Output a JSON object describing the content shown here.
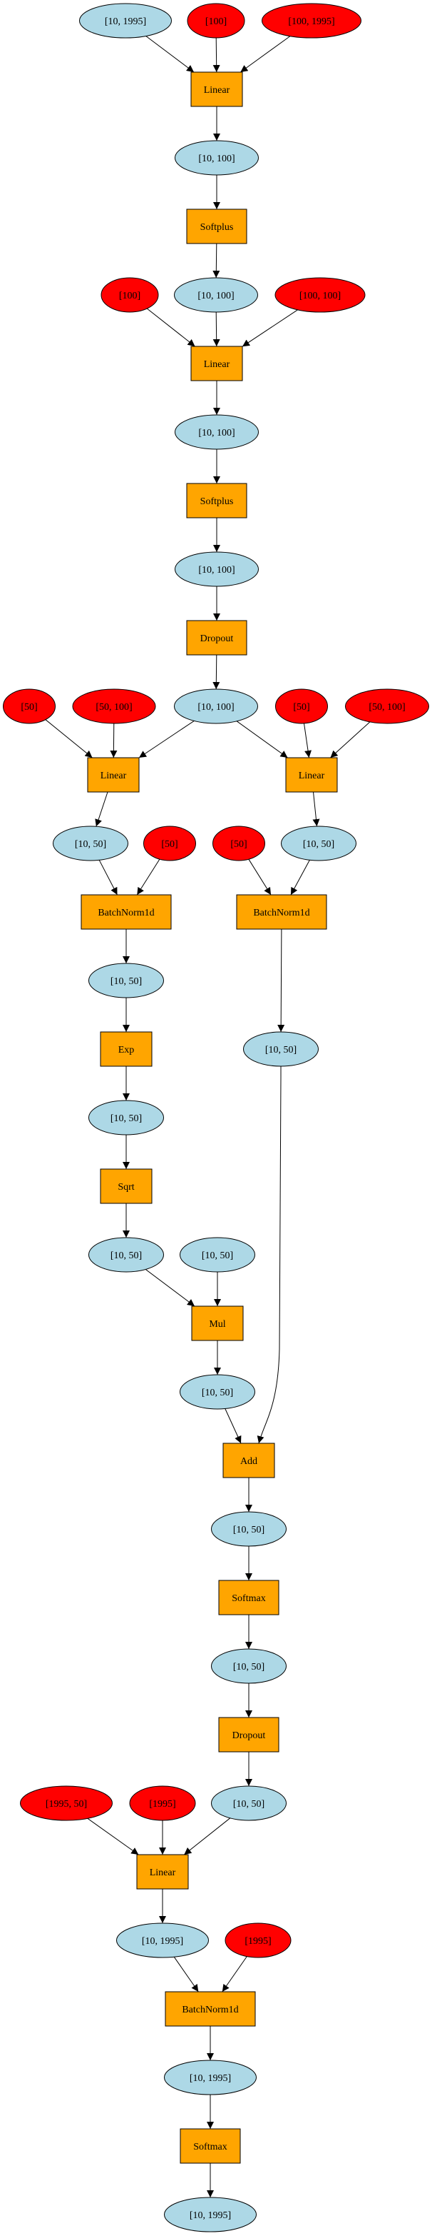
{
  "colors": {
    "tensor": "#add8e6",
    "parameter": "#ff0000",
    "operation": "#ffa500"
  },
  "nodes": [
    {
      "id": "n1",
      "kind": "tensor",
      "label": "[10, 1995]"
    },
    {
      "id": "n2",
      "kind": "parameter",
      "label": "[100]"
    },
    {
      "id": "n3",
      "kind": "parameter",
      "label": "[100, 1995]"
    },
    {
      "id": "op1",
      "kind": "operation",
      "label": "Linear"
    },
    {
      "id": "n4",
      "kind": "tensor",
      "label": "[10, 100]"
    },
    {
      "id": "op2",
      "kind": "operation",
      "label": "Softplus"
    },
    {
      "id": "n5",
      "kind": "parameter",
      "label": "[100]"
    },
    {
      "id": "n6",
      "kind": "tensor",
      "label": "[10, 100]"
    },
    {
      "id": "n7",
      "kind": "parameter",
      "label": "[100, 100]"
    },
    {
      "id": "op3",
      "kind": "operation",
      "label": "Linear"
    },
    {
      "id": "n8",
      "kind": "tensor",
      "label": "[10, 100]"
    },
    {
      "id": "op4",
      "kind": "operation",
      "label": "Softplus"
    },
    {
      "id": "n9",
      "kind": "tensor",
      "label": "[10, 100]"
    },
    {
      "id": "op5",
      "kind": "operation",
      "label": "Dropout"
    },
    {
      "id": "n10",
      "kind": "parameter",
      "label": "[50]"
    },
    {
      "id": "n11",
      "kind": "parameter",
      "label": "[50, 100]"
    },
    {
      "id": "n12",
      "kind": "tensor",
      "label": "[10, 100]"
    },
    {
      "id": "n13",
      "kind": "parameter",
      "label": "[50]"
    },
    {
      "id": "n14",
      "kind": "parameter",
      "label": "[50, 100]"
    },
    {
      "id": "op6",
      "kind": "operation",
      "label": "Linear"
    },
    {
      "id": "op7",
      "kind": "operation",
      "label": "Linear"
    },
    {
      "id": "n15",
      "kind": "tensor",
      "label": "[10, 50]"
    },
    {
      "id": "n16",
      "kind": "parameter",
      "label": "[50]"
    },
    {
      "id": "n17",
      "kind": "parameter",
      "label": "[50]"
    },
    {
      "id": "n18",
      "kind": "tensor",
      "label": "[10, 50]"
    },
    {
      "id": "op8",
      "kind": "operation",
      "label": "BatchNorm1d"
    },
    {
      "id": "op9",
      "kind": "operation",
      "label": "BatchNorm1d"
    },
    {
      "id": "n19",
      "kind": "tensor",
      "label": "[10, 50]"
    },
    {
      "id": "op10",
      "kind": "operation",
      "label": "Exp"
    },
    {
      "id": "n20",
      "kind": "tensor",
      "label": "[10, 50]"
    },
    {
      "id": "n21",
      "kind": "tensor",
      "label": "[10, 50]"
    },
    {
      "id": "op11",
      "kind": "operation",
      "label": "Sqrt"
    },
    {
      "id": "n22",
      "kind": "tensor",
      "label": "[10, 50]"
    },
    {
      "id": "n23",
      "kind": "tensor",
      "label": "[10, 50]"
    },
    {
      "id": "op12",
      "kind": "operation",
      "label": "Mul"
    },
    {
      "id": "n24",
      "kind": "tensor",
      "label": "[10, 50]"
    },
    {
      "id": "op13",
      "kind": "operation",
      "label": "Add"
    },
    {
      "id": "n25",
      "kind": "tensor",
      "label": "[10, 50]"
    },
    {
      "id": "op14",
      "kind": "operation",
      "label": "Softmax"
    },
    {
      "id": "n26",
      "kind": "tensor",
      "label": "[10, 50]"
    },
    {
      "id": "op15",
      "kind": "operation",
      "label": "Dropout"
    },
    {
      "id": "n27",
      "kind": "parameter",
      "label": "[1995, 50]"
    },
    {
      "id": "n28",
      "kind": "parameter",
      "label": "[1995]"
    },
    {
      "id": "n29",
      "kind": "tensor",
      "label": "[10, 50]"
    },
    {
      "id": "op16",
      "kind": "operation",
      "label": "Linear"
    },
    {
      "id": "n30",
      "kind": "tensor",
      "label": "[10, 1995]"
    },
    {
      "id": "n31",
      "kind": "parameter",
      "label": "[1995]"
    },
    {
      "id": "op17",
      "kind": "operation",
      "label": "BatchNorm1d"
    },
    {
      "id": "n32",
      "kind": "tensor",
      "label": "[10, 1995]"
    },
    {
      "id": "op18",
      "kind": "operation",
      "label": "Softmax"
    },
    {
      "id": "n33",
      "kind": "tensor",
      "label": "[10, 1995]"
    }
  ],
  "edges": [
    [
      "n1",
      "op1"
    ],
    [
      "n2",
      "op1"
    ],
    [
      "n3",
      "op1"
    ],
    [
      "op1",
      "n4"
    ],
    [
      "n4",
      "op2"
    ],
    [
      "op2",
      "n6"
    ],
    [
      "n5",
      "op3"
    ],
    [
      "n6",
      "op3"
    ],
    [
      "n7",
      "op3"
    ],
    [
      "op3",
      "n8"
    ],
    [
      "n8",
      "op4"
    ],
    [
      "op4",
      "n9"
    ],
    [
      "n9",
      "op5"
    ],
    [
      "op5",
      "n12"
    ],
    [
      "n10",
      "op6"
    ],
    [
      "n11",
      "op6"
    ],
    [
      "n12",
      "op6"
    ],
    [
      "n12",
      "op7"
    ],
    [
      "n13",
      "op7"
    ],
    [
      "n14",
      "op7"
    ],
    [
      "op6",
      "n15"
    ],
    [
      "op7",
      "n18"
    ],
    [
      "n15",
      "op8"
    ],
    [
      "n16",
      "op8"
    ],
    [
      "n17",
      "op9"
    ],
    [
      "n18",
      "op9"
    ],
    [
      "op8",
      "n19"
    ],
    [
      "op9",
      "n21"
    ],
    [
      "n19",
      "op10"
    ],
    [
      "op10",
      "n20"
    ],
    [
      "n20",
      "op11"
    ],
    [
      "op11",
      "n22"
    ],
    [
      "n22",
      "op12"
    ],
    [
      "n23",
      "op12"
    ],
    [
      "op12",
      "n24"
    ],
    [
      "n24",
      "op13"
    ],
    [
      "n21",
      "op13"
    ],
    [
      "op13",
      "n25"
    ],
    [
      "n25",
      "op14"
    ],
    [
      "op14",
      "n26"
    ],
    [
      "n26",
      "op15"
    ],
    [
      "op15",
      "n29"
    ],
    [
      "n27",
      "op16"
    ],
    [
      "n28",
      "op16"
    ],
    [
      "n29",
      "op16"
    ],
    [
      "op16",
      "n30"
    ],
    [
      "n30",
      "op17"
    ],
    [
      "n31",
      "op17"
    ],
    [
      "op17",
      "n32"
    ],
    [
      "n32",
      "op18"
    ],
    [
      "op18",
      "n33"
    ]
  ]
}
